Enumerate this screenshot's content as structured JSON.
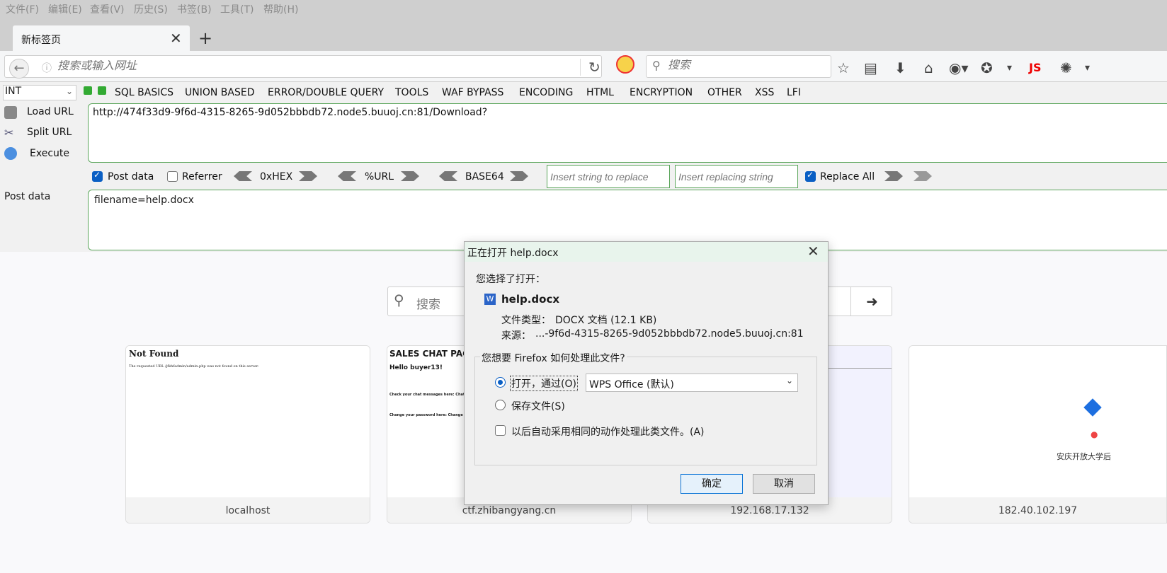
{
  "menubar": [
    "文件(F)",
    "编辑(E)",
    "查看(V)",
    "历史(S)",
    "书签(B)",
    "工具(T)",
    "帮助(H)"
  ],
  "tab": {
    "title": "新标签页",
    "close": "✕",
    "new": "+"
  },
  "navbar": {
    "url_placeholder": "搜索或输入网址",
    "search_placeholder": "搜索",
    "js_badge": "JS"
  },
  "hackbar": {
    "select_value": "INT",
    "menus": [
      "SQL BASICS",
      "UNION BASED",
      "ERROR/DOUBLE QUERY",
      "TOOLS",
      "WAF BYPASS",
      "ENCODING",
      "HTML",
      "ENCRYPTION",
      "OTHER",
      "XSS",
      "LFI"
    ],
    "load_url": "Load URL",
    "split_url": "Split URL",
    "execute": "Execute",
    "url": "http://474f33d9-9f6d-4315-8265-9d052bbbdb72.node5.buuoj.cn:81/Download?",
    "post_data_label": "Post data",
    "referrer_label": "Referrer",
    "hex_label": "0xHEX",
    "urlenc_label": "%URL",
    "base64_label": "BASE64",
    "replace_placeholder": "Insert string to replace",
    "replacing_placeholder": "Insert replacing string",
    "replace_all_label": "Replace All",
    "post_section_label": "Post data",
    "post_body": "filename=help.docx"
  },
  "ntp": {
    "search_placeholder": "搜索",
    "tiles": [
      {
        "label": "localhost",
        "preview_title": "Not Found",
        "preview_text": "The requested URL /jfkhfadmin/admin.php was not found on this server."
      },
      {
        "label": "ctf.zhibangyang.cn",
        "preview_title": "SALES CHAT PAGE",
        "preview_sub": "Hello buyer13!",
        "preview_line1": "Check your chat messages here: Chats",
        "preview_line2": "Change your password here: Change P"
      },
      {
        "label": "192.168.17.132"
      },
      {
        "label": "182.40.102.197",
        "preview_text": "安庆开放大学后"
      }
    ]
  },
  "dialog": {
    "title": "正在打开 help.docx",
    "chosen": "您选择了打开：",
    "filename": "help.docx",
    "type_label": "文件类型：",
    "type_value": "DOCX 文档 (12.1 KB)",
    "source_label": "来源：",
    "source_value": "...-9f6d-4315-8265-9d052bbbdb72.node5.buuoj.cn:81",
    "question": "您想要 Firefox 如何处理此文件?",
    "open_with": "打开，通过(O)",
    "app": "WPS Office (默认)",
    "save": "保存文件(S)",
    "auto": "以后自动采用相同的动作处理此类文件。(A)",
    "ok": "确定",
    "cancel": "取消"
  }
}
